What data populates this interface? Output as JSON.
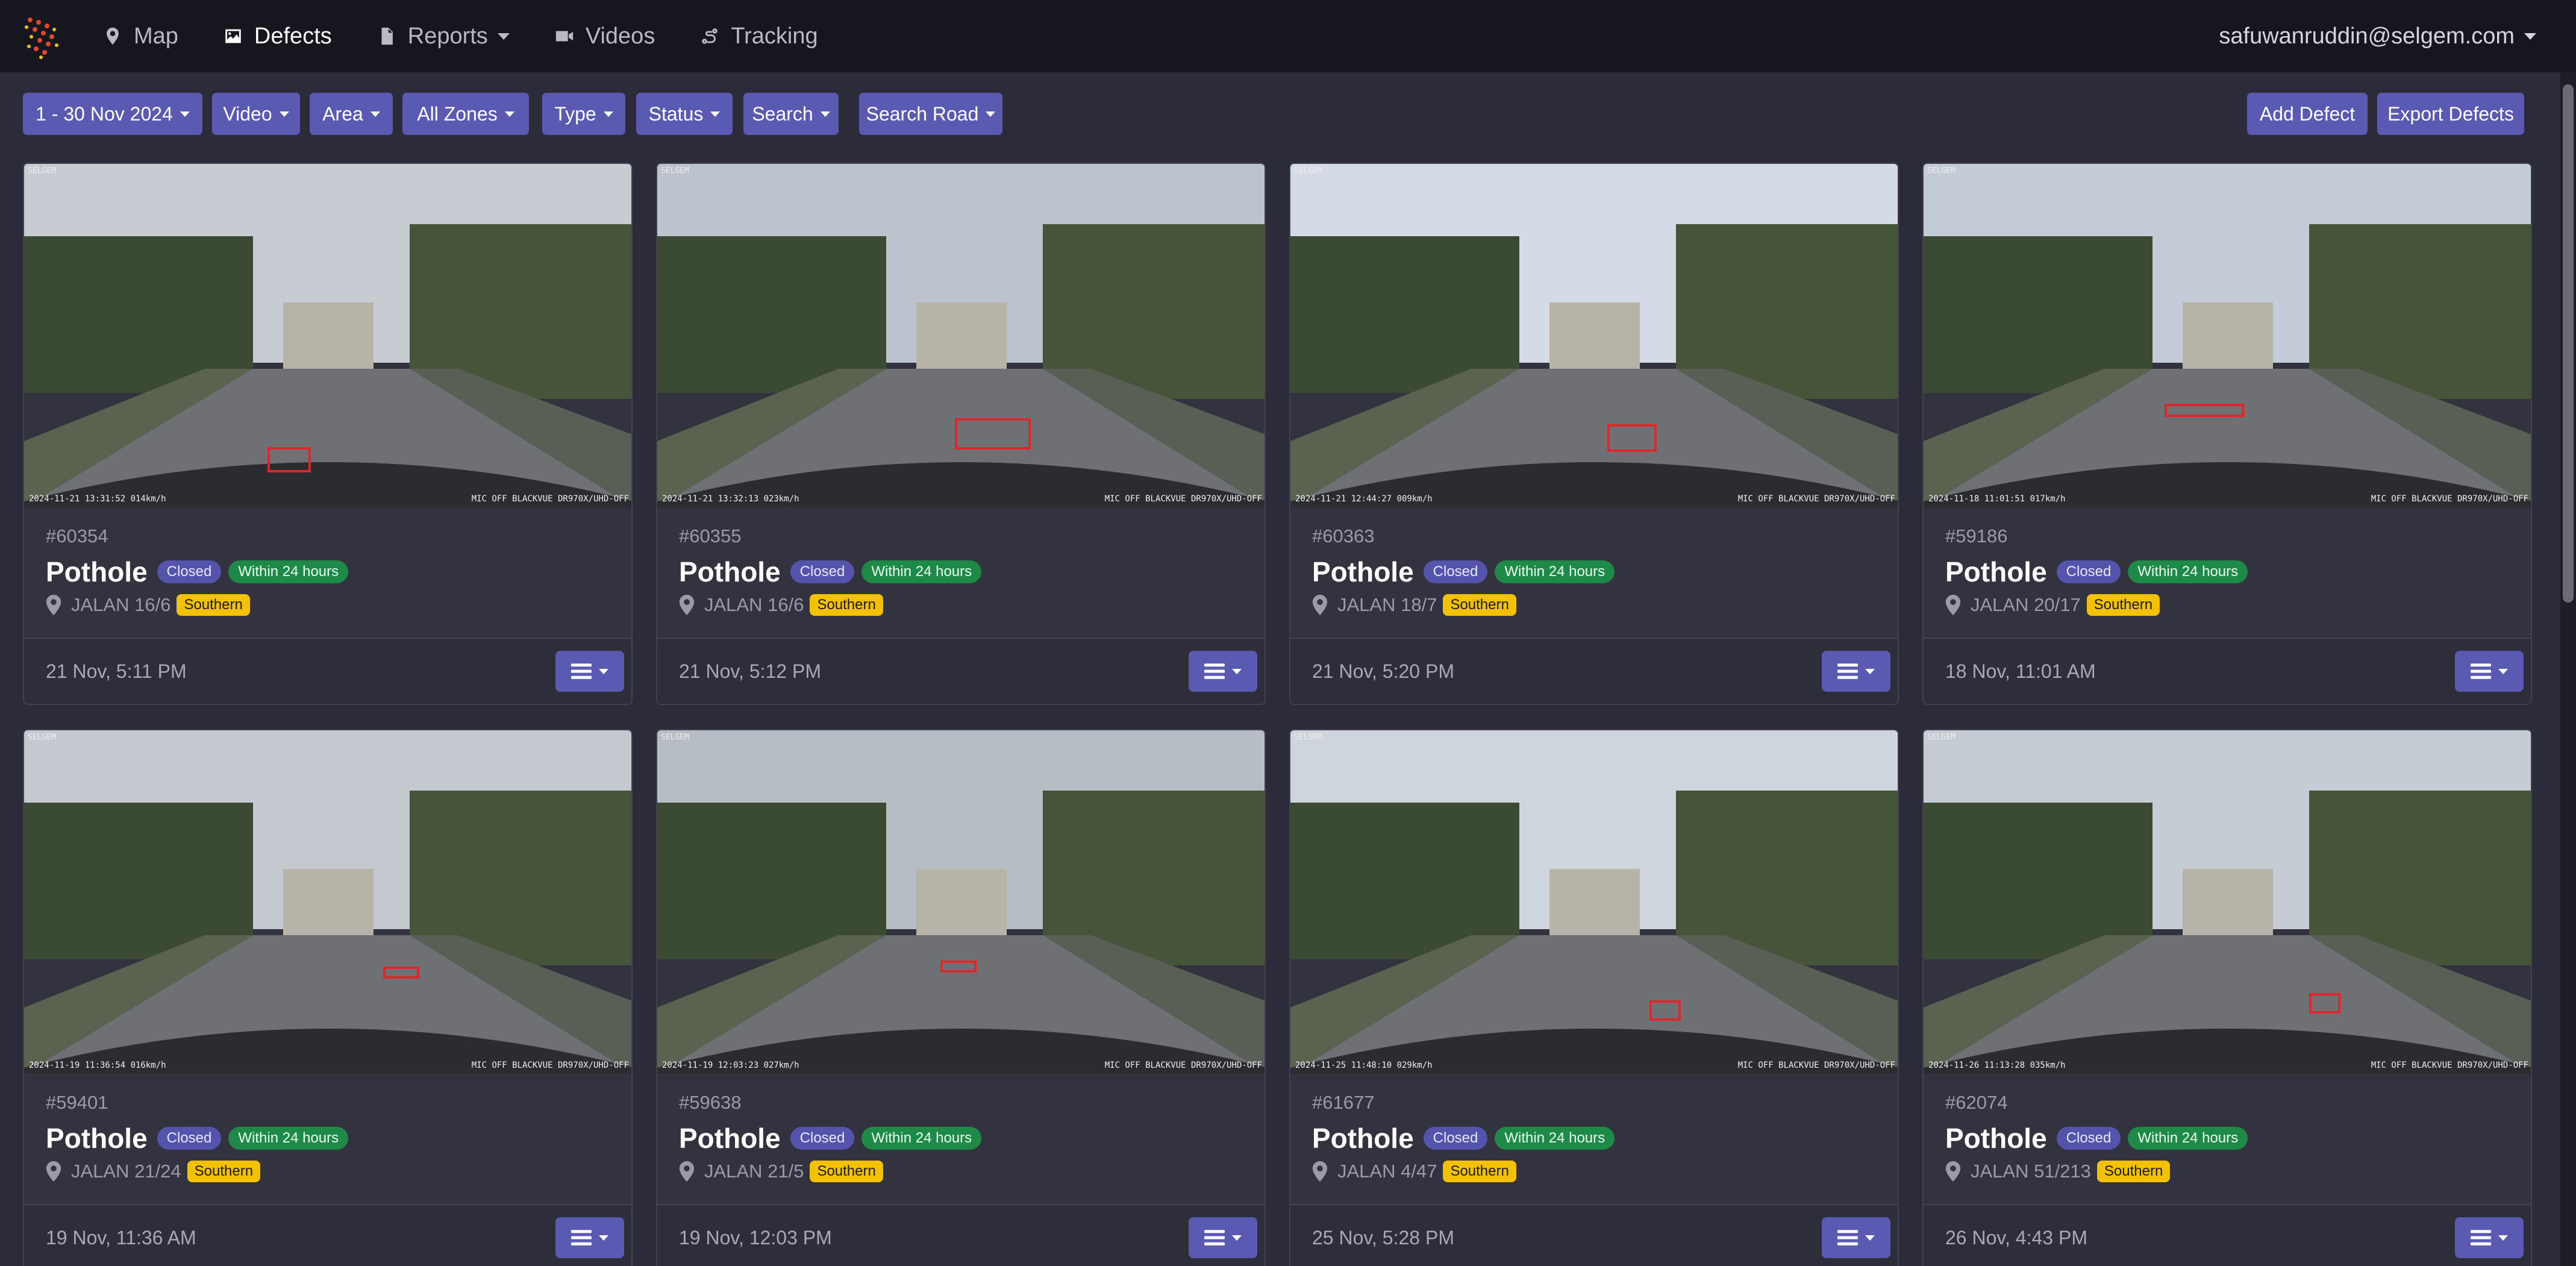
{
  "nav": {
    "items": [
      {
        "label": "Map",
        "icon": "map-pin-icon"
      },
      {
        "label": "Defects",
        "icon": "image-icon",
        "active": true
      },
      {
        "label": "Reports",
        "icon": "file-icon",
        "dropdown": true
      },
      {
        "label": "Videos",
        "icon": "video-icon"
      },
      {
        "label": "Tracking",
        "icon": "route-icon"
      }
    ],
    "user": "safuwanruddin@selgem.com"
  },
  "toolbar": {
    "date_range": "1 - 30 Nov 2024",
    "video": "Video",
    "area": "Area",
    "zones": "All Zones",
    "type": "Type",
    "status": "Status",
    "search": "Search",
    "search_road": "Search Road",
    "add_defect": "Add Defect",
    "export_defects": "Export Defects"
  },
  "colors": {
    "accent": "#5a5ab3",
    "closed_badge": "#5454ad",
    "time_badge": "#1e8a48",
    "zone_badge": "#f4c100",
    "defect_box": "#e0262a"
  },
  "defects": [
    {
      "id": "#60354",
      "type": "Pothole",
      "status": "Closed",
      "sla": "Within 24 hours",
      "road": "JALAN 16/6",
      "zone": "Southern",
      "date": "21 Nov, 5:11 PM",
      "stamp": "2024-11-21 13:31:52 014km/h",
      "cam": "MIC OFF BLACKVUE DR970X/UHD-OFF"
    },
    {
      "id": "#60355",
      "type": "Pothole",
      "status": "Closed",
      "sla": "Within 24 hours",
      "road": "JALAN 16/6",
      "zone": "Southern",
      "date": "21 Nov, 5:12 PM",
      "stamp": "2024-11-21 13:32:13 023km/h",
      "cam": "MIC OFF BLACKVUE DR970X/UHD-OFF"
    },
    {
      "id": "#60363",
      "type": "Pothole",
      "status": "Closed",
      "sla": "Within 24 hours",
      "road": "JALAN 18/7",
      "zone": "Southern",
      "date": "21 Nov, 5:20 PM",
      "stamp": "2024-11-21 12:44:27 009km/h",
      "cam": "MIC OFF BLACKVUE DR970X/UHD-OFF"
    },
    {
      "id": "#59186",
      "type": "Pothole",
      "status": "Closed",
      "sla": "Within 24 hours",
      "road": "JALAN 20/17",
      "zone": "Southern",
      "date": "18 Nov, 11:01 AM",
      "stamp": "2024-11-18 11:01:51 017km/h",
      "cam": "MIC OFF BLACKVUE DR970X/UHD-OFF"
    },
    {
      "id": "#59401",
      "type": "Pothole",
      "status": "Closed",
      "sla": "Within 24 hours",
      "road": "JALAN 21/24",
      "zone": "Southern",
      "date": "19 Nov, 11:36 AM",
      "stamp": "2024-11-19 11:36:54 016km/h",
      "cam": "MIC OFF BLACKVUE DR970X/UHD-OFF"
    },
    {
      "id": "#59638",
      "type": "Pothole",
      "status": "Closed",
      "sla": "Within 24 hours",
      "road": "JALAN 21/5",
      "zone": "Southern",
      "date": "19 Nov, 12:03 PM",
      "stamp": "2024-11-19 12:03:23 027km/h",
      "cam": "MIC OFF BLACKVUE DR970X/UHD-OFF"
    },
    {
      "id": "#61677",
      "type": "Pothole",
      "status": "Closed",
      "sla": "Within 24 hours",
      "road": "JALAN 4/47",
      "zone": "Southern",
      "date": "25 Nov, 5:28 PM",
      "stamp": "2024-11-25 11:48:10 029km/h",
      "cam": "MIC OFF BLACKVUE DR970X/UHD-OFF"
    },
    {
      "id": "#62074",
      "type": "Pothole",
      "status": "Closed",
      "sla": "Within 24 hours",
      "road": "JALAN 51/213",
      "zone": "Southern",
      "date": "26 Nov, 4:43 PM",
      "stamp": "2024-11-26 11:13:28 035km/h",
      "cam": "MIC OFF BLACKVUE DR970X/UHD-OFF"
    }
  ]
}
